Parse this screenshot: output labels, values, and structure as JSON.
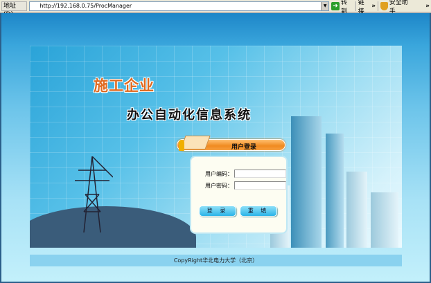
{
  "browser": {
    "address_label": "地址(D)",
    "url": "http://192.168.0.75/ProcManager",
    "go_label": "转到",
    "links_label": "链接",
    "chevron": "»",
    "assistant_label": "安全助手"
  },
  "banner": {
    "company": "施工企业",
    "system_title": "办公自动化信息系统"
  },
  "login": {
    "header": "用户登录",
    "user_code_label": "用户编码：",
    "user_code_value": "",
    "password_label": "用户密码：",
    "password_value": "",
    "login_button": "登 录",
    "reset_button": "重 填"
  },
  "footer": {
    "copyright": "CopyRight华北电力大学（北京）"
  }
}
